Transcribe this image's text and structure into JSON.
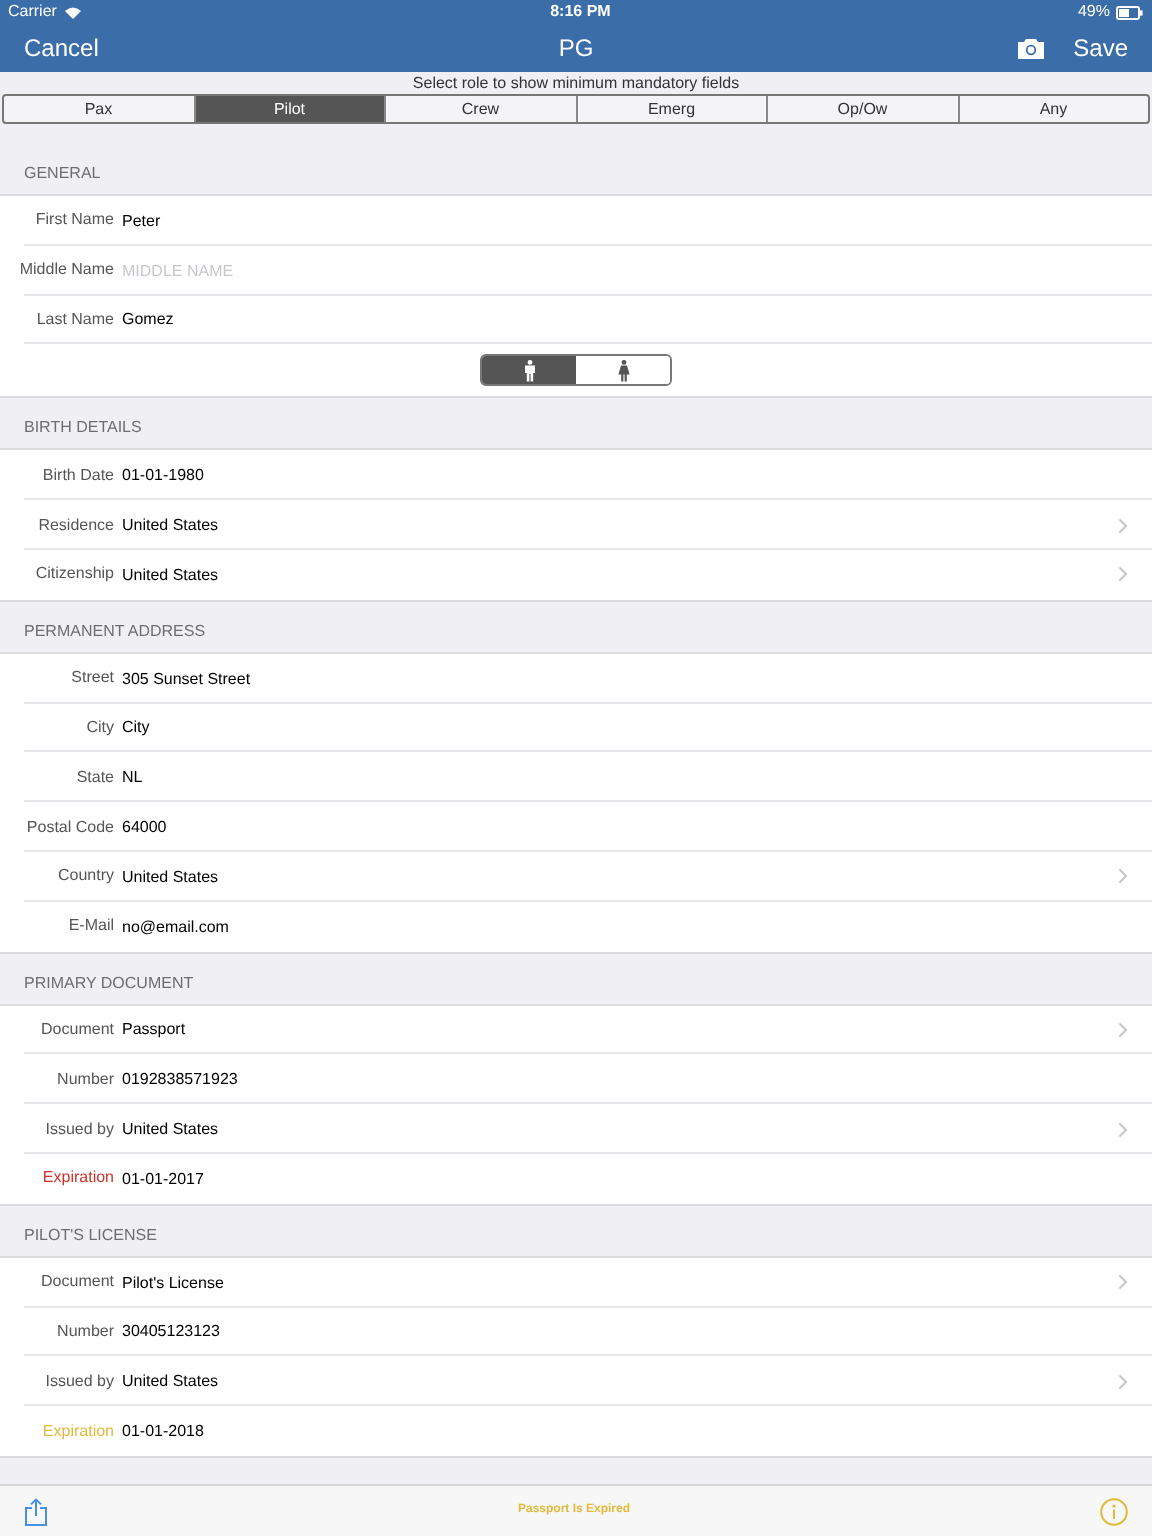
{
  "status_bar": {
    "carrier": "Carrier",
    "time": "8:16 PM",
    "battery": "49%"
  },
  "nav_bar": {
    "cancel": "Cancel",
    "title": "PG",
    "save": "Save"
  },
  "role_picker": {
    "prompt": "Select role to show minimum mandatory fields",
    "roles": [
      {
        "label": "Pax",
        "selected": false
      },
      {
        "label": "Pilot",
        "selected": true
      },
      {
        "label": "Crew",
        "selected": false
      },
      {
        "label": "Emerg",
        "selected": false
      },
      {
        "label": "Op/Ow",
        "selected": false
      },
      {
        "label": "Any",
        "selected": false
      }
    ]
  },
  "sections": [
    {
      "title": "GENERAL",
      "rows": [
        {
          "kind": "text",
          "label": "First Name",
          "value": "Peter"
        },
        {
          "kind": "text",
          "label": "Middle Name",
          "placeholder": "MIDDLE NAME"
        },
        {
          "kind": "text",
          "label": "Last Name",
          "value": "Gomez"
        },
        {
          "kind": "gender",
          "options": [
            {
              "kind": "male",
              "selected": true
            },
            {
              "kind": "female",
              "selected": false
            }
          ]
        }
      ]
    },
    {
      "title": "BIRTH DETAILS",
      "rows": [
        {
          "kind": "text",
          "label": "Birth Date",
          "value": "01-01-1980"
        },
        {
          "kind": "picker",
          "label": "Residence",
          "value": "United States"
        },
        {
          "kind": "picker",
          "label": "Citizenship",
          "value": "United States"
        }
      ]
    },
    {
      "title": "PERMANENT ADDRESS",
      "rows": [
        {
          "kind": "text",
          "label": "Street",
          "value": "305 Sunset Street"
        },
        {
          "kind": "text",
          "label": "City",
          "value": "City"
        },
        {
          "kind": "text",
          "label": "State",
          "value": "NL"
        },
        {
          "kind": "text",
          "label": "Postal Code",
          "value": "64000"
        },
        {
          "kind": "picker",
          "label": "Country",
          "value": "United States"
        },
        {
          "kind": "text",
          "label": "E-Mail",
          "value": "no@email.com"
        }
      ]
    },
    {
      "title": "PRIMARY DOCUMENT",
      "rows": [
        {
          "kind": "picker",
          "label": "Document",
          "value": "Passport"
        },
        {
          "kind": "text",
          "label": "Number",
          "value": "0192838571923"
        },
        {
          "kind": "picker",
          "label": "Issued by",
          "value": "United States"
        },
        {
          "kind": "text",
          "label": "Expiration",
          "value": "01-01-2017",
          "color": "#d0312d"
        }
      ]
    },
    {
      "title": "PILOT'S LICENSE",
      "rows": [
        {
          "kind": "picker",
          "label": "Document",
          "value": "Pilot's License"
        },
        {
          "kind": "text",
          "label": "Number",
          "value": "30405123123"
        },
        {
          "kind": "picker",
          "label": "Issued by",
          "value": "United States"
        },
        {
          "kind": "text",
          "label": "Expiration",
          "value": "01-01-2018",
          "color": "#e2b93b"
        }
      ]
    }
  ],
  "toolbar": {
    "message": "Passport Is Expired"
  }
}
